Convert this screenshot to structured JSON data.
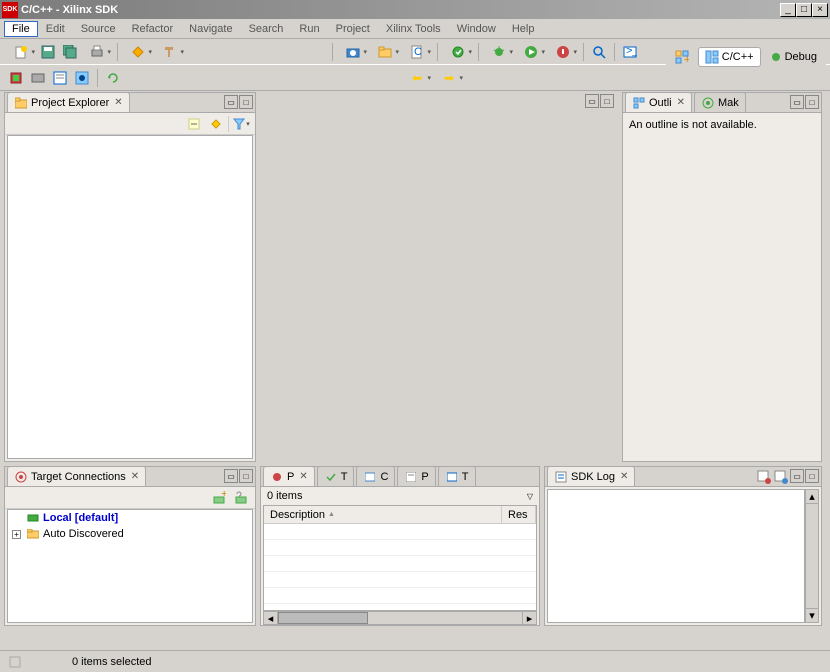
{
  "window": {
    "title": "C/C++ - Xilinx SDK"
  },
  "menu": [
    "File",
    "Edit",
    "Source",
    "Refactor",
    "Navigate",
    "Search",
    "Run",
    "Project",
    "Xilinx Tools",
    "Window",
    "Help"
  ],
  "perspectives": {
    "cpp": "C/C++",
    "debug": "Debug"
  },
  "project_explorer": {
    "title": "Project Explorer"
  },
  "target_connections": {
    "title": "Target Connections",
    "items": [
      {
        "label": "Local [default]",
        "bold": true,
        "color": "#0000cc"
      },
      {
        "label": "Auto Discovered",
        "expandable": true
      }
    ]
  },
  "outline": {
    "tab1": "Outli",
    "tab2": "Mak",
    "message": "An outline is not available."
  },
  "problems": {
    "tabs": [
      "P",
      "T",
      "C",
      "P",
      "T"
    ],
    "count_label": "0 items",
    "columns": [
      "Description",
      "Res"
    ]
  },
  "sdklog": {
    "title": "SDK Log"
  },
  "status": {
    "items_selected": "0 items selected"
  }
}
